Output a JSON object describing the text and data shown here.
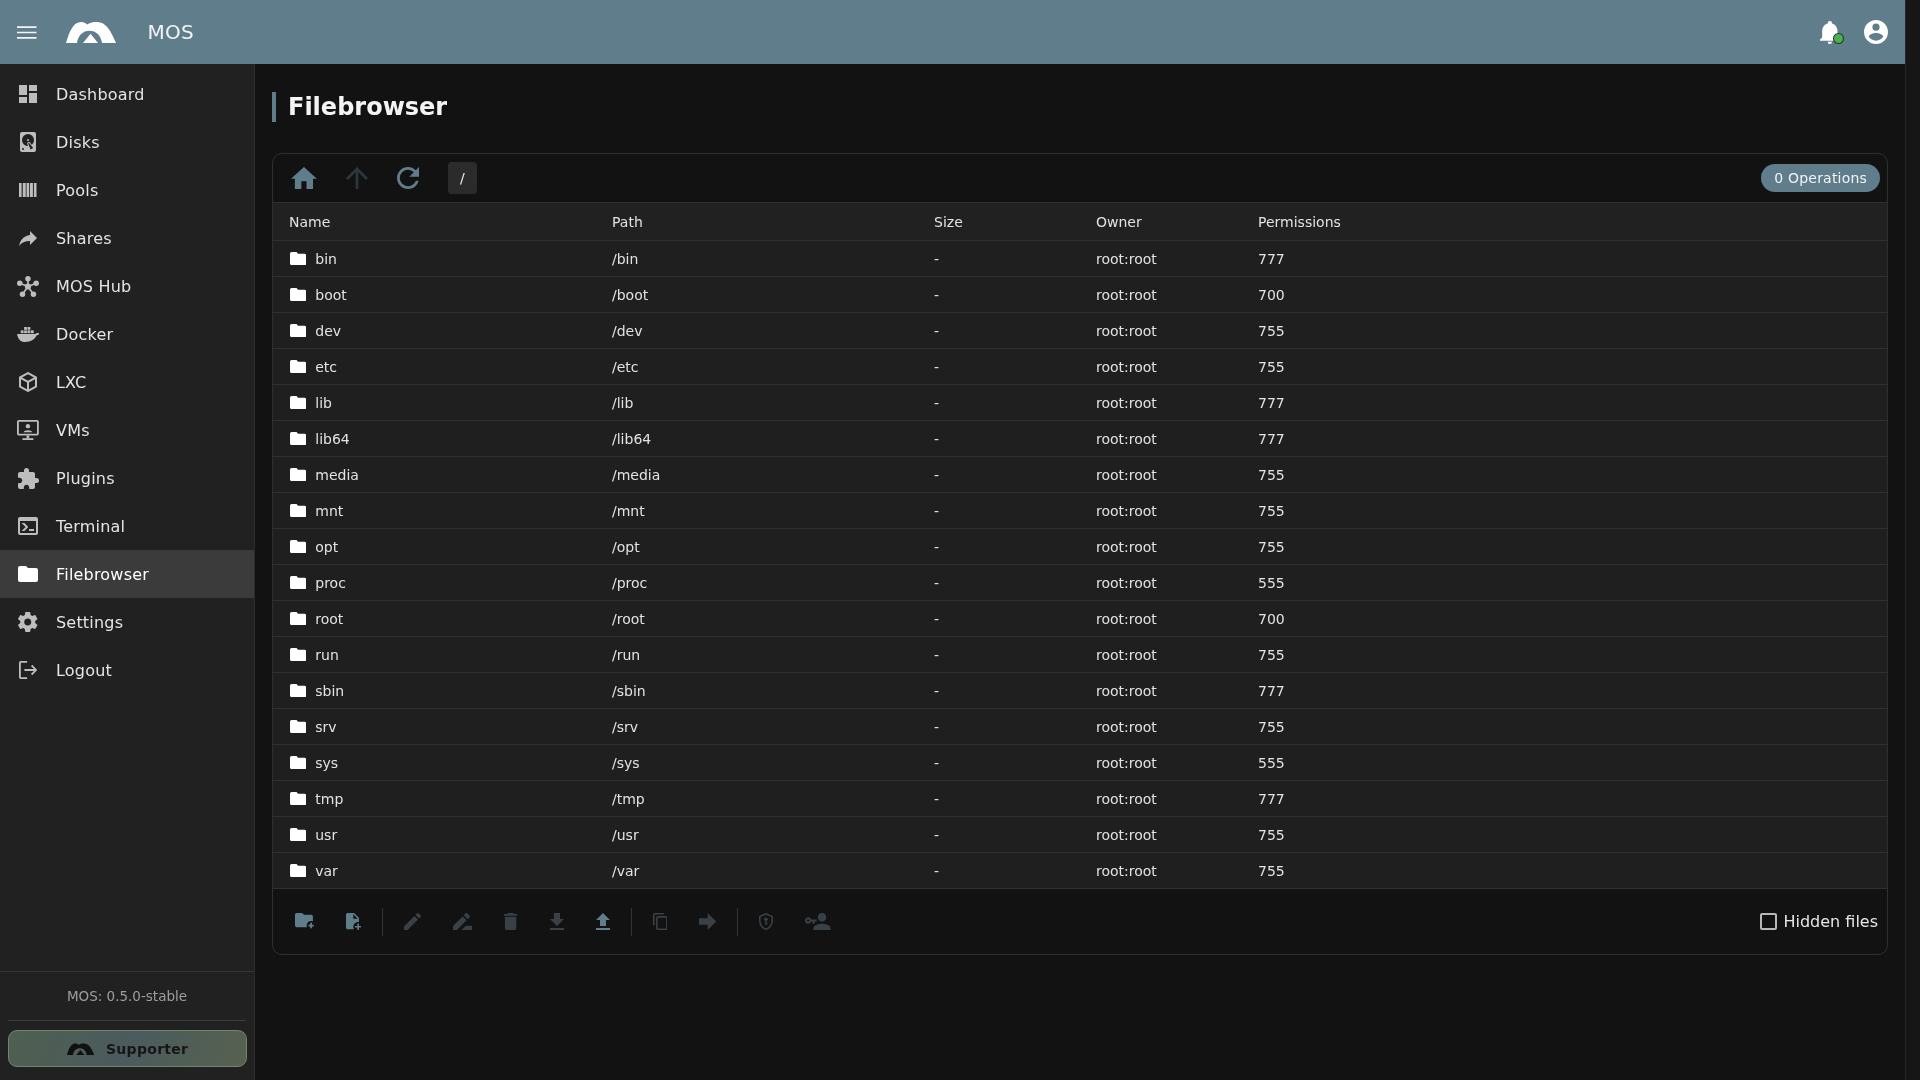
{
  "top_bar": {
    "title": "MOS"
  },
  "sidebar": {
    "items": [
      {
        "label": "Dashboard",
        "selected": false
      },
      {
        "label": "Disks",
        "selected": false
      },
      {
        "label": "Pools",
        "selected": false
      },
      {
        "label": "Shares",
        "selected": false
      },
      {
        "label": "MOS Hub",
        "selected": false
      },
      {
        "label": "Docker",
        "selected": false
      },
      {
        "label": "LXC",
        "selected": false
      },
      {
        "label": "VMs",
        "selected": false
      },
      {
        "label": "Plugins",
        "selected": false
      },
      {
        "label": "Terminal",
        "selected": false
      },
      {
        "label": "Filebrowser",
        "selected": true
      },
      {
        "label": "Settings",
        "selected": false
      },
      {
        "label": "Logout",
        "selected": false
      }
    ],
    "version": "MOS: 0.5.0-stable",
    "supporter_button": "Supporter"
  },
  "page": {
    "title": "Filebrowser"
  },
  "file_browser": {
    "nav_buttons": [
      {
        "disabled": false
      },
      {
        "disabled": true
      },
      {
        "disabled": false
      }
    ],
    "path": "/",
    "operations": "0 Operations",
    "table": {
      "columns": [
        "Name",
        "Path",
        "Size",
        "Owner",
        "Permissions"
      ],
      "rows": [
        {
          "name": "bin",
          "path": "/bin",
          "size": "-",
          "owner": "root:root",
          "permissions": "777"
        },
        {
          "name": "boot",
          "path": "/boot",
          "size": "-",
          "owner": "root:root",
          "permissions": "700"
        },
        {
          "name": "dev",
          "path": "/dev",
          "size": "-",
          "owner": "root:root",
          "permissions": "755"
        },
        {
          "name": "etc",
          "path": "/etc",
          "size": "-",
          "owner": "root:root",
          "permissions": "755"
        },
        {
          "name": "lib",
          "path": "/lib",
          "size": "-",
          "owner": "root:root",
          "permissions": "777"
        },
        {
          "name": "lib64",
          "path": "/lib64",
          "size": "-",
          "owner": "root:root",
          "permissions": "777"
        },
        {
          "name": "media",
          "path": "/media",
          "size": "-",
          "owner": "root:root",
          "permissions": "755"
        },
        {
          "name": "mnt",
          "path": "/mnt",
          "size": "-",
          "owner": "root:root",
          "permissions": "755"
        },
        {
          "name": "opt",
          "path": "/opt",
          "size": "-",
          "owner": "root:root",
          "permissions": "755"
        },
        {
          "name": "proc",
          "path": "/proc",
          "size": "-",
          "owner": "root:root",
          "permissions": "555"
        },
        {
          "name": "root",
          "path": "/root",
          "size": "-",
          "owner": "root:root",
          "permissions": "700"
        },
        {
          "name": "run",
          "path": "/run",
          "size": "-",
          "owner": "root:root",
          "permissions": "755"
        },
        {
          "name": "sbin",
          "path": "/sbin",
          "size": "-",
          "owner": "root:root",
          "permissions": "777"
        },
        {
          "name": "srv",
          "path": "/srv",
          "size": "-",
          "owner": "root:root",
          "permissions": "755"
        },
        {
          "name": "sys",
          "path": "/sys",
          "size": "-",
          "owner": "root:root",
          "permissions": "555"
        },
        {
          "name": "tmp",
          "path": "/tmp",
          "size": "-",
          "owner": "root:root",
          "permissions": "777"
        },
        {
          "name": "usr",
          "path": "/usr",
          "size": "-",
          "owner": "root:root",
          "permissions": "755"
        },
        {
          "name": "var",
          "path": "/var",
          "size": "-",
          "owner": "root:root",
          "permissions": "755"
        }
      ]
    },
    "action_groups": [
      {
        "actions": [
          {
            "disabled": false
          },
          {
            "disabled": false
          }
        ]
      },
      {
        "actions": [
          {
            "disabled": true
          },
          {
            "disabled": true
          },
          {
            "disabled": true
          },
          {
            "disabled": true
          },
          {
            "disabled": false
          }
        ]
      },
      {
        "actions": [
          {
            "disabled": true
          },
          {
            "disabled": true
          }
        ]
      },
      {
        "actions": [
          {
            "disabled": true
          },
          {
            "disabled": true
          }
        ]
      }
    ],
    "hidden_files": {
      "label": "Hidden files",
      "checked": false
    }
  }
}
